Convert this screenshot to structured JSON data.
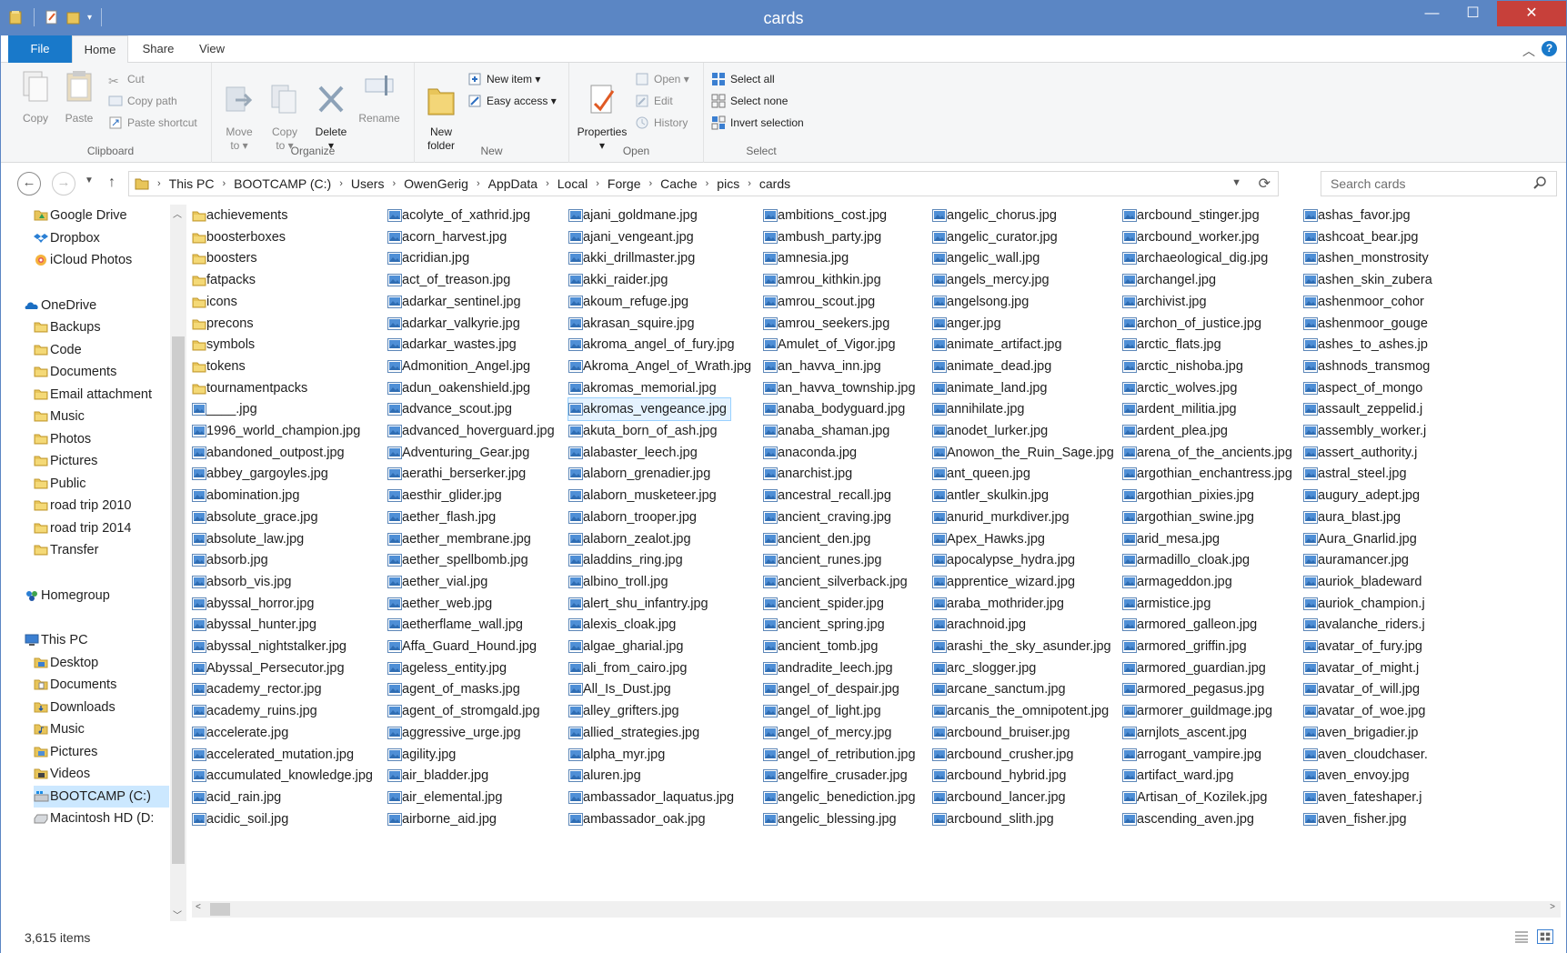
{
  "window": {
    "title": "cards"
  },
  "window_controls": {
    "minimize": "—",
    "maximize": "☐",
    "close": "✕"
  },
  "ribbon_tabs": {
    "file": "File",
    "home": "Home",
    "share": "Share",
    "view": "View"
  },
  "ribbon": {
    "clipboard": {
      "label": "Clipboard",
      "copy": "Copy",
      "paste": "Paste",
      "cut": "Cut",
      "copy_path": "Copy path",
      "paste_shortcut": "Paste shortcut"
    },
    "organize": {
      "label": "Organize",
      "move_to": "Move\nto ▾",
      "copy_to": "Copy\nto ▾",
      "delete": "Delete\n▾",
      "rename": "Rename"
    },
    "new": {
      "label": "New",
      "new_folder": "New\nfolder",
      "new_item": "New item ▾",
      "easy_access": "Easy access ▾"
    },
    "open": {
      "label": "Open",
      "properties": "Properties\n▾",
      "open": "Open ▾",
      "edit": "Edit",
      "history": "History"
    },
    "select": {
      "label": "Select",
      "select_all": "Select all",
      "select_none": "Select none",
      "invert_selection": "Invert selection"
    }
  },
  "address": {
    "breadcrumbs": [
      "This PC",
      "BOOTCAMP (C:)",
      "Users",
      "OwenGerig",
      "AppData",
      "Local",
      "Forge",
      "Cache",
      "pics",
      "cards"
    ]
  },
  "search": {
    "placeholder": "Search cards"
  },
  "nav": {
    "items": [
      {
        "label": "Google Drive",
        "icon": "google-drive-folder-icon",
        "level": 1
      },
      {
        "label": "Dropbox",
        "icon": "dropbox-icon",
        "level": 1
      },
      {
        "label": "iCloud Photos",
        "icon": "icloud-photos-icon",
        "level": 1
      },
      {
        "label": "",
        "icon": "",
        "level": 0
      },
      {
        "label": "OneDrive",
        "icon": "onedrive-icon",
        "level": 0
      },
      {
        "label": "Backups",
        "icon": "folder-icon",
        "level": 1
      },
      {
        "label": "Code",
        "icon": "folder-icon",
        "level": 1
      },
      {
        "label": "Documents",
        "icon": "folder-icon",
        "level": 1
      },
      {
        "label": "Email attachment",
        "icon": "folder-icon",
        "level": 1
      },
      {
        "label": "Music",
        "icon": "folder-icon",
        "level": 1
      },
      {
        "label": "Photos",
        "icon": "folder-icon",
        "level": 1
      },
      {
        "label": "Pictures",
        "icon": "folder-icon",
        "level": 1
      },
      {
        "label": "Public",
        "icon": "folder-icon",
        "level": 1
      },
      {
        "label": "road trip 2010",
        "icon": "folder-icon",
        "level": 1
      },
      {
        "label": "road trip 2014",
        "icon": "folder-icon",
        "level": 1
      },
      {
        "label": "Transfer",
        "icon": "folder-icon",
        "level": 1
      },
      {
        "label": "",
        "icon": "",
        "level": 0
      },
      {
        "label": "Homegroup",
        "icon": "homegroup-icon",
        "level": 0
      },
      {
        "label": "",
        "icon": "",
        "level": 0
      },
      {
        "label": "This PC",
        "icon": "this-pc-icon",
        "level": 0
      },
      {
        "label": "Desktop",
        "icon": "desktop-folder-icon",
        "level": 1
      },
      {
        "label": "Documents",
        "icon": "documents-folder-icon",
        "level": 1
      },
      {
        "label": "Downloads",
        "icon": "downloads-folder-icon",
        "level": 1
      },
      {
        "label": "Music",
        "icon": "music-folder-icon",
        "level": 1
      },
      {
        "label": "Pictures",
        "icon": "pictures-folder-icon",
        "level": 1
      },
      {
        "label": "Videos",
        "icon": "videos-folder-icon",
        "level": 1
      },
      {
        "label": "BOOTCAMP (C:)",
        "icon": "windows-drive-icon",
        "level": 1,
        "selected": true
      },
      {
        "label": "Macintosh HD (D:",
        "icon": "drive-icon",
        "level": 1
      }
    ]
  },
  "files": {
    "columns": [
      [
        "achievements",
        "boosterboxes",
        "boosters",
        "fatpacks",
        "icons",
        "precons",
        "symbols",
        "tokens",
        "tournamentpacks",
        "____.jpg",
        "1996_world_champion.jpg",
        "abandoned_outpost.jpg",
        "abbey_gargoyles.jpg",
        "abomination.jpg",
        "absolute_grace.jpg",
        "absolute_law.jpg",
        "absorb.jpg",
        "absorb_vis.jpg",
        "abyssal_horror.jpg",
        "abyssal_hunter.jpg",
        "abyssal_nightstalker.jpg",
        "Abyssal_Persecutor.jpg",
        "academy_rector.jpg",
        "academy_ruins.jpg",
        "accelerate.jpg",
        "accelerated_mutation.jpg",
        "accumulated_knowledge.jpg",
        "acid_rain.jpg",
        "acidic_soil.jpg"
      ],
      [
        "acolyte_of_xathrid.jpg",
        "acorn_harvest.jpg",
        "acridian.jpg",
        "act_of_treason.jpg",
        "adarkar_sentinel.jpg",
        "adarkar_valkyrie.jpg",
        "adarkar_wastes.jpg",
        "Admonition_Angel.jpg",
        "adun_oakenshield.jpg",
        "advance_scout.jpg",
        "advanced_hoverguard.jpg",
        "Adventuring_Gear.jpg",
        "aerathi_berserker.jpg",
        "aesthir_glider.jpg",
        "aether_flash.jpg",
        "aether_membrane.jpg",
        "aether_spellbomb.jpg",
        "aether_vial.jpg",
        "aether_web.jpg",
        "aetherflame_wall.jpg",
        "Affa_Guard_Hound.jpg",
        "ageless_entity.jpg",
        "agent_of_masks.jpg",
        "agent_of_stromgald.jpg",
        "aggressive_urge.jpg",
        "agility.jpg",
        "air_bladder.jpg",
        "air_elemental.jpg",
        "airborne_aid.jpg"
      ],
      [
        "ajani_goldmane.jpg",
        "ajani_vengeant.jpg",
        "akki_drillmaster.jpg",
        "akki_raider.jpg",
        "akoum_refuge.jpg",
        "akrasan_squire.jpg",
        "akroma_angel_of_fury.jpg",
        "Akroma_Angel_of_Wrath.jpg",
        "akromas_memorial.jpg",
        "akromas_vengeance.jpg",
        "akuta_born_of_ash.jpg",
        "alabaster_leech.jpg",
        "alaborn_grenadier.jpg",
        "alaborn_musketeer.jpg",
        "alaborn_trooper.jpg",
        "alaborn_zealot.jpg",
        "aladdins_ring.jpg",
        "albino_troll.jpg",
        "alert_shu_infantry.jpg",
        "alexis_cloak.jpg",
        "algae_gharial.jpg",
        "ali_from_cairo.jpg",
        "All_Is_Dust.jpg",
        "alley_grifters.jpg",
        "allied_strategies.jpg",
        "alpha_myr.jpg",
        "aluren.jpg",
        "ambassador_laquatus.jpg",
        "ambassador_oak.jpg"
      ],
      [
        "ambitions_cost.jpg",
        "ambush_party.jpg",
        "amnesia.jpg",
        "amrou_kithkin.jpg",
        "amrou_scout.jpg",
        "amrou_seekers.jpg",
        "Amulet_of_Vigor.jpg",
        "an_havva_inn.jpg",
        "an_havva_township.jpg",
        "anaba_bodyguard.jpg",
        "anaba_shaman.jpg",
        "anaconda.jpg",
        "anarchist.jpg",
        "ancestral_recall.jpg",
        "ancient_craving.jpg",
        "ancient_den.jpg",
        "ancient_runes.jpg",
        "ancient_silverback.jpg",
        "ancient_spider.jpg",
        "ancient_spring.jpg",
        "ancient_tomb.jpg",
        "andradite_leech.jpg",
        "angel_of_despair.jpg",
        "angel_of_light.jpg",
        "angel_of_mercy.jpg",
        "angel_of_retribution.jpg",
        "angelfire_crusader.jpg",
        "angelic_benediction.jpg",
        "angelic_blessing.jpg"
      ],
      [
        "angelic_chorus.jpg",
        "angelic_curator.jpg",
        "angelic_wall.jpg",
        "angels_mercy.jpg",
        "angelsong.jpg",
        "anger.jpg",
        "animate_artifact.jpg",
        "animate_dead.jpg",
        "animate_land.jpg",
        "annihilate.jpg",
        "anodet_lurker.jpg",
        "Anowon_the_Ruin_Sage.jpg",
        "ant_queen.jpg",
        "antler_skulkin.jpg",
        "anurid_murkdiver.jpg",
        "Apex_Hawks.jpg",
        "apocalypse_hydra.jpg",
        "apprentice_wizard.jpg",
        "araba_mothrider.jpg",
        "arachnoid.jpg",
        "arashi_the_sky_asunder.jpg",
        "arc_slogger.jpg",
        "arcane_sanctum.jpg",
        "arcanis_the_omnipotent.jpg",
        "arcbound_bruiser.jpg",
        "arcbound_crusher.jpg",
        "arcbound_hybrid.jpg",
        "arcbound_lancer.jpg",
        "arcbound_slith.jpg"
      ],
      [
        "arcbound_stinger.jpg",
        "arcbound_worker.jpg",
        "archaeological_dig.jpg",
        "archangel.jpg",
        "archivist.jpg",
        "archon_of_justice.jpg",
        "arctic_flats.jpg",
        "arctic_nishoba.jpg",
        "arctic_wolves.jpg",
        "ardent_militia.jpg",
        "ardent_plea.jpg",
        "arena_of_the_ancients.jpg",
        "argothian_enchantress.jpg",
        "argothian_pixies.jpg",
        "argothian_swine.jpg",
        "arid_mesa.jpg",
        "armadillo_cloak.jpg",
        "armageddon.jpg",
        "armistice.jpg",
        "armored_galleon.jpg",
        "armored_griffin.jpg",
        "armored_guardian.jpg",
        "armored_pegasus.jpg",
        "armorer_guildmage.jpg",
        "arnjlots_ascent.jpg",
        "arrogant_vampire.jpg",
        "artifact_ward.jpg",
        "Artisan_of_Kozilek.jpg",
        "ascending_aven.jpg"
      ],
      [
        "ashas_favor.jpg",
        "ashcoat_bear.jpg",
        "ashen_monstrosity",
        "ashen_skin_zubera",
        "ashenmoor_cohor",
        "ashenmoor_gouge",
        "ashes_to_ashes.jp",
        "ashnods_transmog",
        "aspect_of_mongo",
        "assault_zeppelid.j",
        "assembly_worker.j",
        "assert_authority.j",
        "astral_steel.jpg",
        "augury_adept.jpg",
        "aura_blast.jpg",
        "Aura_Gnarlid.jpg",
        "auramancer.jpg",
        "auriok_bladeward",
        "auriok_champion.j",
        "avalanche_riders.j",
        "avatar_of_fury.jpg",
        "avatar_of_might.j",
        "avatar_of_will.jpg",
        "avatar_of_woe.jpg",
        "aven_brigadier.jp",
        "aven_cloudchaser.",
        "aven_envoy.jpg",
        "aven_fateshaper.j",
        "aven_fisher.jpg"
      ]
    ],
    "folder_count": 9,
    "selected": "akromas_vengeance.jpg"
  },
  "status": {
    "item_count": "3,615 items"
  }
}
